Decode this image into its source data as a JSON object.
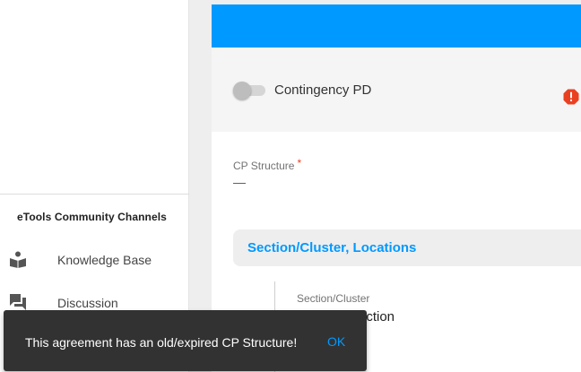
{
  "sidebar": {
    "channels_heading": "eTools Community Channels",
    "items": [
      {
        "label": "Knowledge Base",
        "icon": "book-reader-icon"
      },
      {
        "label": "Discussion",
        "icon": "forum-icon"
      }
    ]
  },
  "main": {
    "contingency": {
      "label": "Contingency PD",
      "enabled": false
    },
    "cp_structure": {
      "label": "CP Structure",
      "required_mark": "*",
      "value": "—"
    },
    "section": {
      "title": "Section/Cluster, Locations",
      "field_label": "Section/Cluster",
      "field_value_partial": "ection"
    }
  },
  "toast": {
    "message": "This agreement has an old/expired CP Structure!",
    "action": "OK"
  },
  "colors": {
    "accent": "#0099ff",
    "warning": "#ea4022",
    "toast_bg": "#323232"
  }
}
